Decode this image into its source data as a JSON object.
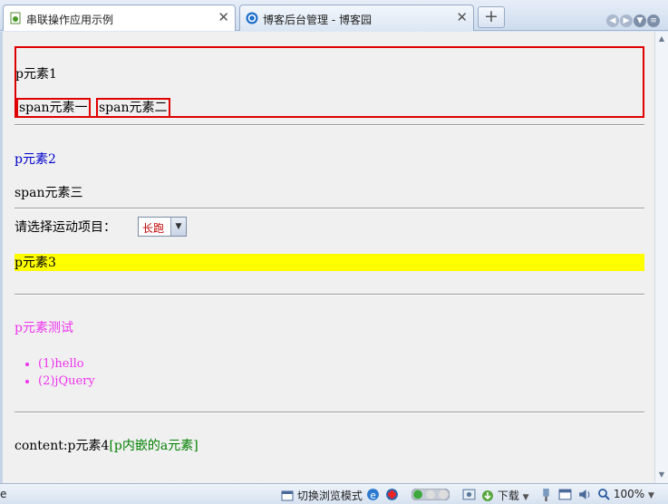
{
  "tabs": [
    {
      "label": "串联操作应用示例",
      "close": "✕"
    },
    {
      "label": "博客后台管理 - 博客园",
      "close": "✕"
    }
  ],
  "new_tab": "+",
  "status_left": "e",
  "content": {
    "p1": "p元素1",
    "span1": "span元素一",
    "span2": "span元素二",
    "p2": "p元素2",
    "span3": "span元素三",
    "select_label": "请选择运动项目：",
    "select_value": "长跑",
    "p3": "p元素3",
    "p_test": "p元素测试",
    "list_items": [
      "(1)hello",
      "(2)jQuery"
    ],
    "content_prefix": "content:p元素4",
    "content_link": "[p内嵌的a元素]"
  },
  "status": {
    "switch_mode": "切换浏览模式",
    "download": "下载",
    "zoom": "100%"
  },
  "colors": {
    "red_border": "#e00000",
    "blue_text": "#0000cc",
    "yellow_bg": "#ffff00",
    "magenta_text": "#ee33ee",
    "green_text": "#008000"
  }
}
